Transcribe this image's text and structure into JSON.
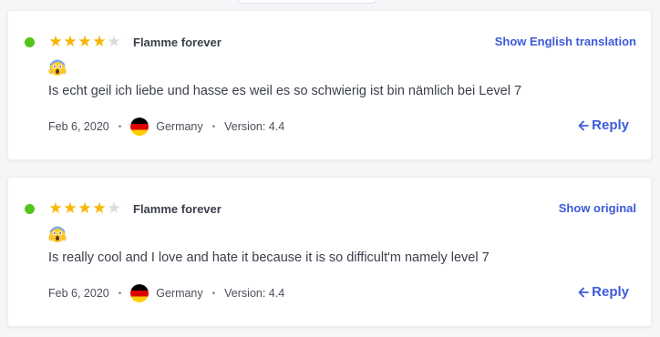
{
  "theme": {
    "accent": "#3d5adb",
    "star_filled": "#f7b500",
    "star_empty": "#d9dbe0",
    "status_green": "#52c41a"
  },
  "reviews": [
    {
      "rating": 4,
      "max_rating": 5,
      "reviewer": "Flamme forever",
      "toggle_label": "Show English translation",
      "emoji_icon": "face-screaming-in-fear-icon",
      "text": "Is echt geil ich liebe und hasse es weil es so schwierig ist bin nämlich bei Level 7",
      "date": "Feb 6, 2020",
      "country": "Germany",
      "version": "Version: 4.4",
      "reply_label": "Reply"
    },
    {
      "rating": 4,
      "max_rating": 5,
      "reviewer": "Flamme forever",
      "toggle_label": "Show original",
      "emoji_icon": "face-screaming-in-fear-icon",
      "text": "Is really cool and I love and hate it because it is so difficult'm namely level 7",
      "date": "Feb 6, 2020",
      "country": "Germany",
      "version": "Version: 4.4",
      "reply_label": "Reply"
    }
  ]
}
